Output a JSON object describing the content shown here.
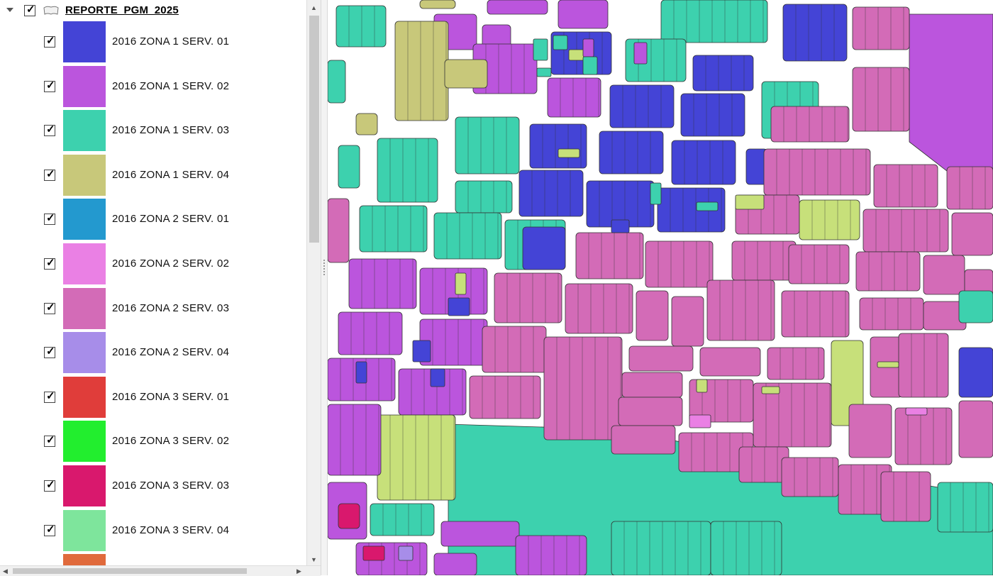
{
  "layers_panel": {
    "group": {
      "label": "REPORTE_PGM_2025",
      "checked": true,
      "expanded": true,
      "icon": "polygon-layer-icon"
    },
    "legend": [
      {
        "label": "2016 ZONA 1 SERV. 01",
        "color": "#4444d6",
        "checked": true
      },
      {
        "label": "2016 ZONA 1 SERV. 02",
        "color": "#bb55dd",
        "checked": true
      },
      {
        "label": "2016 ZONA 1 SERV. 03",
        "color": "#3dd1ae",
        "checked": true
      },
      {
        "label": "2016 ZONA 1 SERV. 04",
        "color": "#c8c87a",
        "checked": true
      },
      {
        "label": "2016 ZONA 2 SERV. 01",
        "color": "#2399cf",
        "checked": true
      },
      {
        "label": "2016 ZONA 2 SERV. 02",
        "color": "#ea80e4",
        "checked": true
      },
      {
        "label": "2016 ZONA 2 SERV. 03",
        "color": "#d36bb7",
        "checked": true
      },
      {
        "label": "2016 ZONA 2 SERV. 04",
        "color": "#a78de9",
        "checked": true
      },
      {
        "label": "2016 ZONA 3 SERV. 01",
        "color": "#e03d3a",
        "checked": true
      },
      {
        "label": "2016 ZONA 3 SERV. 02",
        "color": "#22ee2e",
        "checked": true
      },
      {
        "label": "2016 ZONA 3 SERV. 03",
        "color": "#d9186d",
        "checked": true
      },
      {
        "label": "2016 ZONA 3 SERV. 04",
        "color": "#7ee59c",
        "checked": true
      },
      {
        "label": "",
        "color": "#e06a3c",
        "checked": false
      }
    ]
  },
  "map": {
    "colors": {
      "road": "#ffffff",
      "outline": "#333333",
      "lime": "#c7e07a"
    }
  }
}
